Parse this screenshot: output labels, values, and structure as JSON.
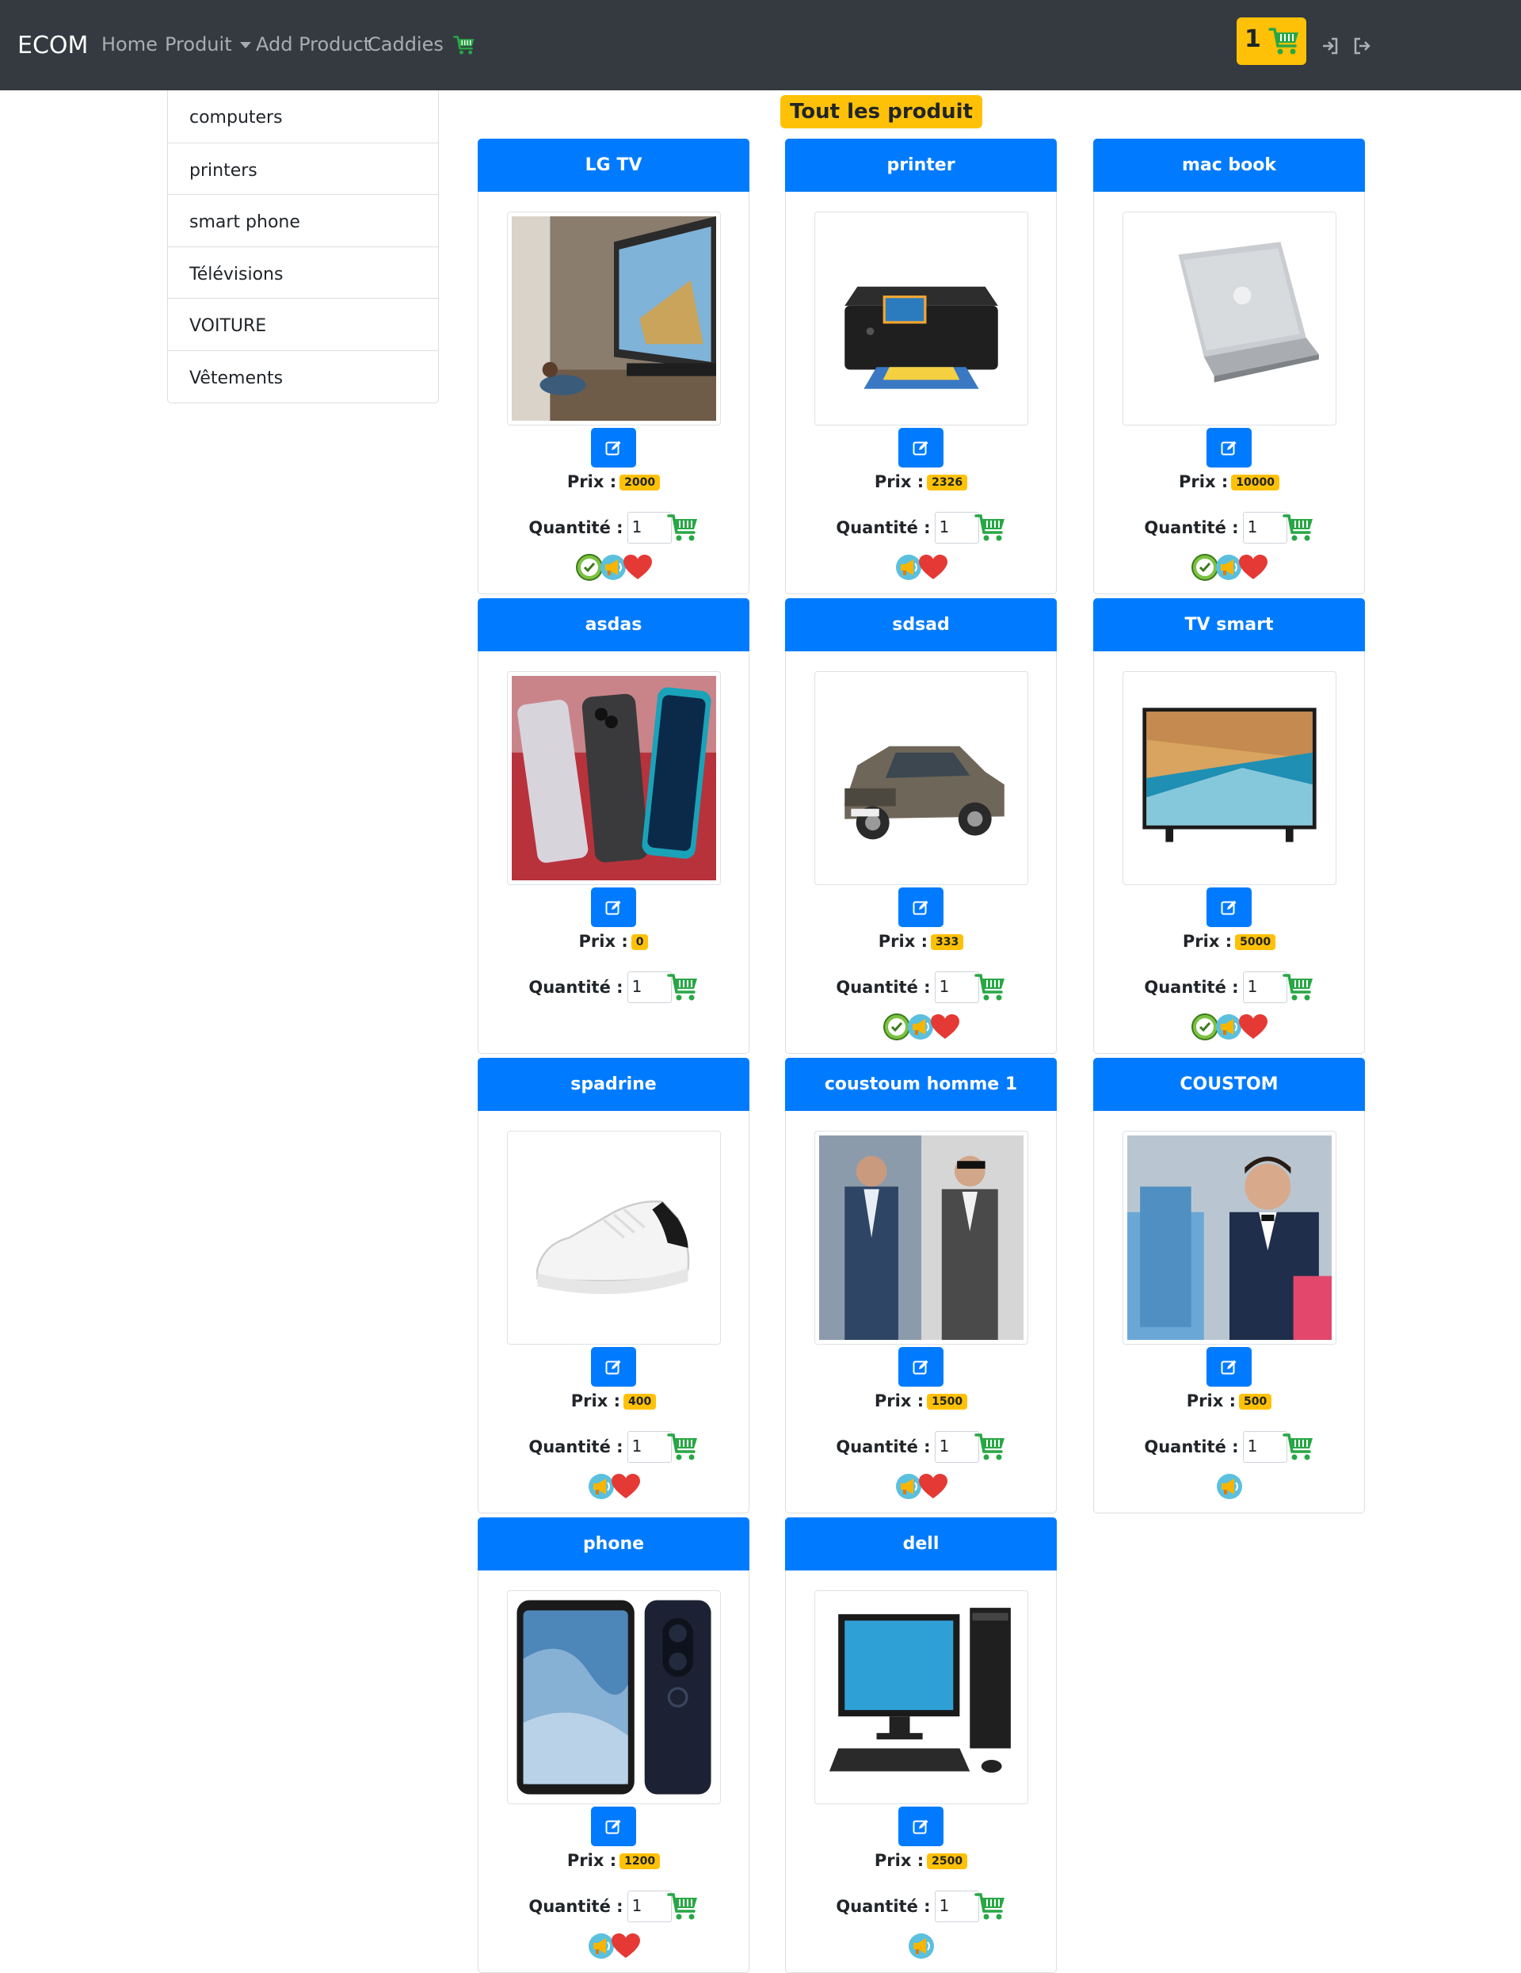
{
  "navbar": {
    "brand": "ECOM",
    "links": [
      {
        "label": "Home"
      },
      {
        "label": "Produit"
      },
      {
        "label": "Add Product"
      },
      {
        "label": "Caddies"
      }
    ],
    "cart_count": "1"
  },
  "sidebar": {
    "categories": [
      {
        "label": "computers"
      },
      {
        "label": "printers"
      },
      {
        "label": "smart phone"
      },
      {
        "label": "Télévisions"
      },
      {
        "label": "VOITURE"
      },
      {
        "label": "Vêtements"
      }
    ]
  },
  "main": {
    "title": "Tout les produit",
    "price_label": "Prix :",
    "qty_label": "Quantité :",
    "products": [
      {
        "name": "LG TV",
        "price": "2000",
        "qty": "1",
        "image": "tv-living-room",
        "badges": [
          "in-stock-icon",
          "promo-megaphone-icon",
          "heart-icon"
        ]
      },
      {
        "name": "printer",
        "price": "2326",
        "qty": "1",
        "image": "printer",
        "badges": [
          "promo-megaphone-icon",
          "heart-icon"
        ]
      },
      {
        "name": "mac book",
        "price": "10000",
        "qty": "1",
        "image": "laptop",
        "badges": [
          "in-stock-icon",
          "promo-megaphone-icon",
          "heart-icon"
        ]
      },
      {
        "name": "asdas",
        "price": "0",
        "qty": "1",
        "image": "smartphones",
        "badges": []
      },
      {
        "name": "sdsad",
        "price": "333",
        "qty": "1",
        "image": "car",
        "badges": [
          "in-stock-icon",
          "promo-megaphone-icon",
          "heart-icon"
        ]
      },
      {
        "name": "TV smart",
        "price": "5000",
        "qty": "1",
        "image": "smart-tv",
        "badges": [
          "in-stock-icon",
          "promo-megaphone-icon",
          "heart-icon"
        ]
      },
      {
        "name": "spadrine",
        "price": "400",
        "qty": "1",
        "image": "sneaker",
        "badges": [
          "promo-megaphone-icon",
          "heart-icon"
        ]
      },
      {
        "name": "coustoum homme 1",
        "price": "1500",
        "qty": "1",
        "image": "men-suits",
        "badges": [
          "promo-megaphone-icon",
          "heart-icon"
        ]
      },
      {
        "name": "COUSTOM",
        "price": "500",
        "qty": "1",
        "image": "man-shopping",
        "badges": [
          "promo-megaphone-icon"
        ]
      },
      {
        "name": "phone",
        "price": "1200",
        "qty": "1",
        "image": "phone",
        "badges": [
          "promo-megaphone-icon",
          "heart-icon"
        ]
      },
      {
        "name": "dell",
        "price": "2500",
        "qty": "1",
        "image": "desktop-computer",
        "badges": [
          "promo-megaphone-icon"
        ]
      }
    ]
  },
  "colors": {
    "navbar_bg": "#343a40",
    "primary": "#007bff",
    "warning": "#ffc107",
    "cart_green": "#28a745",
    "heart_red": "#e53935"
  },
  "icons": {
    "cart": "shopping-cart-icon",
    "login": "sign-in-icon",
    "logout": "sign-out-icon",
    "edit": "edit-icon"
  }
}
